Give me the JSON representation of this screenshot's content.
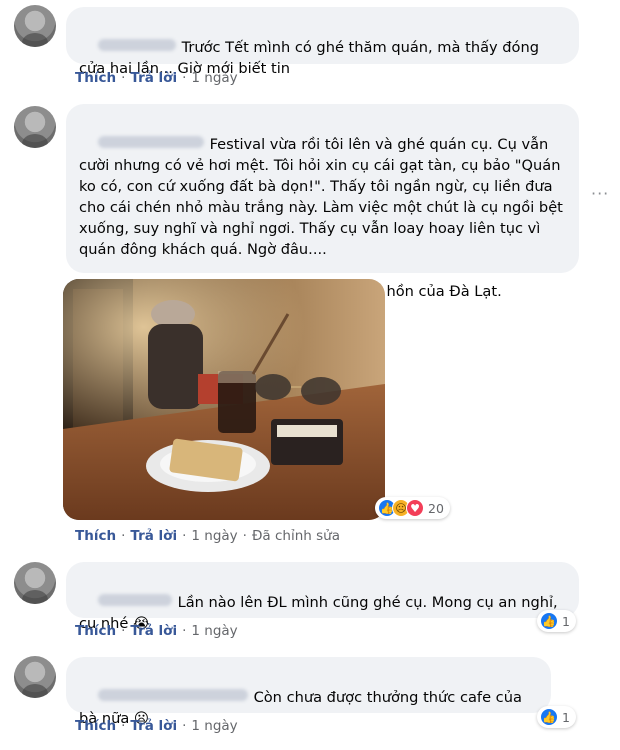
{
  "colors": {
    "bubble_bg": "#f0f2f5",
    "action_link": "#385898",
    "meta_text": "#65676b",
    "like_blue": "#1877f2"
  },
  "actions": {
    "like": "Thích",
    "reply": "Trả lời",
    "dot": "·"
  },
  "comments": [
    {
      "text": "Trước Tết mình có ghé thăm quán, mà thấy đóng cửa hai lần... Giờ mới biết tin",
      "time": "1 ngày"
    },
    {
      "text": "Festival vừa rồi tôi lên và ghé quán cụ. Cụ vẫn cười nhưng có vẻ hơi mệt. Tôi hỏi xin cụ cái gạt tàn, cụ bảo \"Quán ko có, con cứ xuống đất bà dọn!\". Thấy tôi ngần ngừ, cụ liền đưa cho cái chén nhỏ màu trắng này. Làm việc một chút là cụ ngồi bệt xuống, suy nghĩ và nghỉ ngơi. Thấy cụ vẫn loay hoay liên tục vì quán đông khách quá. Ngờ đâu....\n\nChúc cụ an nghỉ, cụ nhé. Người giữ lại cái hồn của Đà Lạt.",
      "time": "1 ngày",
      "edited": "Đã chỉnh sửa",
      "reaction_count": "20",
      "reaction_icons": [
        "like-icon",
        "sad-icon",
        "love-icon"
      ]
    },
    {
      "text": "Lần nào lên ĐL mình cũng ghé cụ. Mong cụ an nghỉ, cụ nhé 😭",
      "time": "1 ngày",
      "reaction_count": "1",
      "reaction_icons": [
        "like-icon"
      ]
    },
    {
      "text": "Còn chưa được thưởng thức cafe của bà nữa 😦",
      "time": "1 ngày",
      "reaction_count": "1",
      "reaction_icons": [
        "like-icon"
      ]
    }
  ],
  "more_icon": "more-options-icon",
  "more_label": "···"
}
